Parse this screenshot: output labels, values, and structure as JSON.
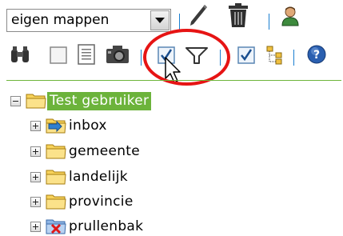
{
  "toolbar": {
    "folder_select": {
      "value": "eigen mappen"
    },
    "icons_row1": [
      "edit-pencil-icon",
      "delete-trash-icon",
      "user-icon"
    ],
    "icons_row2": [
      "binoculars-icon",
      "select-none-checkbox-icon",
      "document-icon",
      "camera-icon",
      "check-all-icon",
      "filter-icon",
      "checkbox-icon",
      "tree-structure-icon",
      "help-icon"
    ]
  },
  "annotation": {
    "highlight_color": "#e61414"
  },
  "accent_color": "#6cb33b",
  "tree": {
    "root": {
      "label": "Test gebruiker",
      "expanded": true
    },
    "children": [
      {
        "label": "inbox",
        "icon": "inbox-folder-icon"
      },
      {
        "label": "gemeente",
        "icon": "folder-icon"
      },
      {
        "label": "landelijk",
        "icon": "folder-icon"
      },
      {
        "label": "provincie",
        "icon": "folder-icon"
      },
      {
        "label": "prullenbak",
        "icon": "trash-folder-icon"
      }
    ]
  }
}
